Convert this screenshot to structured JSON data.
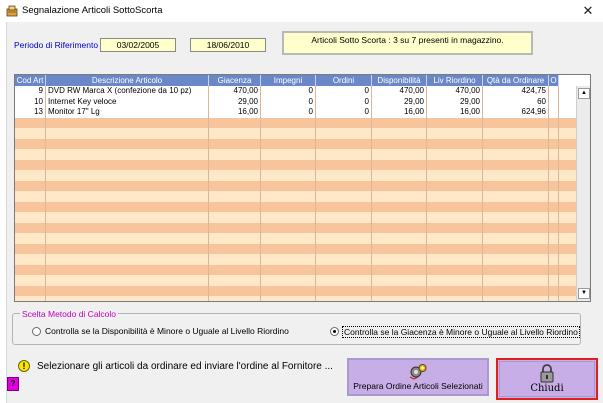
{
  "window": {
    "title": "Segnalazione Articoli SottoScorta",
    "close_glyph": "✕"
  },
  "periodo": {
    "label": "Periodo di Riferimento",
    "start": "03/02/2005",
    "end": "18/06/2010"
  },
  "info": "Articoli Sotto Scorta : 3 su 7 presenti in magazzino.",
  "grid": {
    "columns": [
      "Cod Art",
      "Descrizione Articolo",
      "Giacenza",
      "Impegni",
      "Ordini",
      "Disponibilità",
      "Liv Riordino",
      "Qtà da Ordinare",
      "O"
    ],
    "rows": [
      [
        "9",
        "DVD RW Marca X (confezione da 10 pz)",
        "470,00",
        "0",
        "0",
        "470,00",
        "470,00",
        "424,75"
      ],
      [
        "10",
        "Internet Key veloce",
        "29,00",
        "0",
        "0",
        "29,00",
        "29,00",
        "60"
      ],
      [
        "13",
        "Monitor 17\" Lg",
        "16,00",
        "0",
        "0",
        "16,00",
        "16,00",
        "624,96"
      ]
    ],
    "scroll_up_glyph": "▲",
    "scroll_down_glyph": "▼"
  },
  "scelta": {
    "legend": "Scelta Metodo di Calcolo",
    "option1": "Controlla se la Disponibilità è Minore o Uguale al Livello Riordino",
    "option2": "Controlla se la Giacenza è Minore o Uguale al Livello Riordino",
    "selected": "option2"
  },
  "footer": {
    "warning_glyph": "!",
    "message": "Selezionare gli articoli da ordinare ed inviare l'ordine al Fornitore ...",
    "help_glyph": "?",
    "prepara_label": "Prepara Ordine Articoli Selezionati",
    "chiudi_label": "Chiudi"
  },
  "colors": {
    "header_bg": "#6a87c8",
    "row_light": "#fee8c8",
    "row_dark": "#f8c49c",
    "button_bg": "#c8aee6",
    "close_border": "#e02020",
    "legend_color": "#c000c0"
  },
  "icons": [
    "app-icon",
    "close-icon",
    "warning-icon",
    "help-icon",
    "gears-icon",
    "padlock-icon"
  ]
}
